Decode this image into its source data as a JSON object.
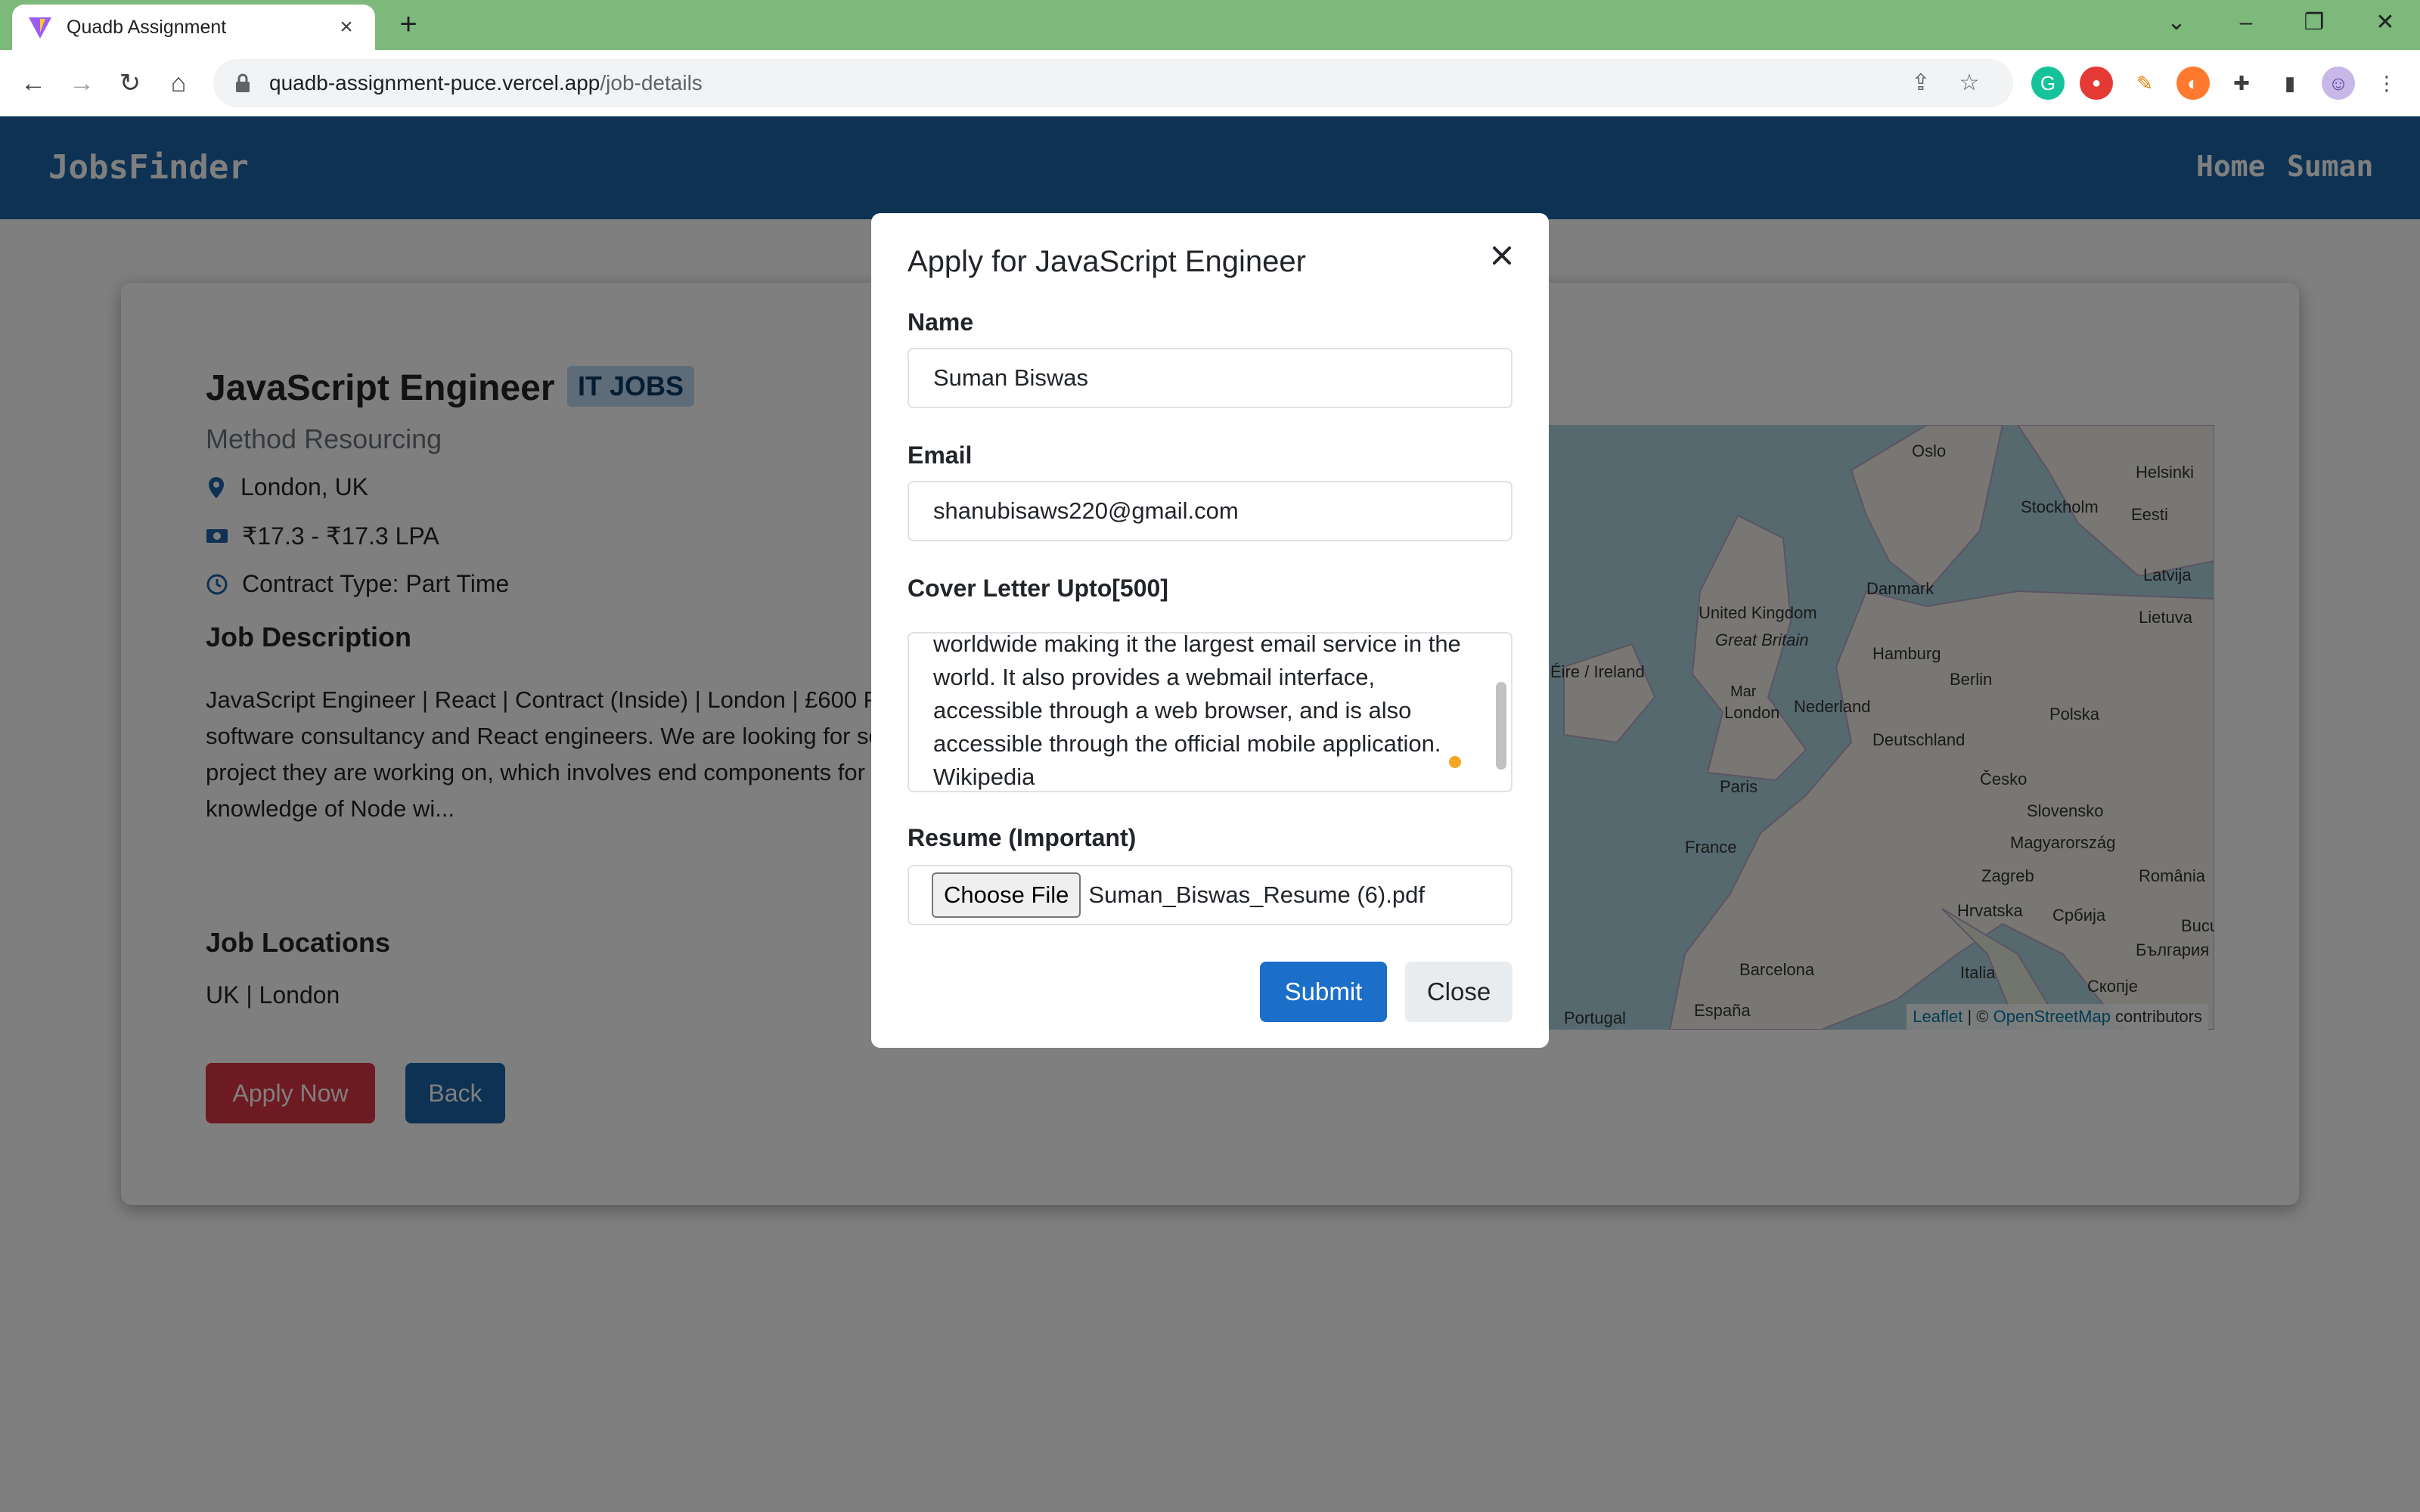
{
  "browser": {
    "tab_title": "Quadb Assignment",
    "url_host": "quadb-assignment-puce.vercel.app",
    "url_path": "/job-details"
  },
  "navbar": {
    "brand": "JobsFinder",
    "home": "Home",
    "user": "Suman"
  },
  "job": {
    "title": "JavaScript Engineer",
    "badge": "IT JOBS",
    "company": "Method Resourcing",
    "location": "London, UK",
    "salary": "₹17.3 - ₹17.3 LPA",
    "contract": "Contract Type: Part Time",
    "description_heading": "Job Description",
    "description": "JavaScript Engineer | React | Contract (Inside) | London | £600 P Method Resourcing has partnered with a software consultancy and React engineers. We are looking for somebody with very g TypeScript for the project they are working on, which involves end components for their end-clients. The task will involve a M knowledge of Node wi...",
    "locations_heading": "Job Locations",
    "locations": "UK | London",
    "apply_label": "Apply Now",
    "back_label": "Back"
  },
  "map": {
    "labels": [
      "Oslo",
      "Helsinki",
      "Stockholm",
      "Eesti",
      "Latvija",
      "Lietuva",
      "Danmark",
      "United Kingdom",
      "Great Britain",
      "Éire / Ireland",
      "Hamburg",
      "Berlin",
      "Nederland",
      "Polska",
      "London",
      "Deutschland",
      "Česko",
      "Paris",
      "Slovensko",
      "France",
      "Magyarország",
      "Zagreb",
      "România",
      "Hrvatska",
      "Србија",
      "Bucu",
      "България",
      "Barcelona",
      "Italia",
      "Скопје",
      "España",
      "Portugal"
    ],
    "marker_alt": "Mar",
    "attribution_leaflet": "Leaflet",
    "attribution_sep": " | © ",
    "attribution_osm": "OpenStreetMap",
    "attribution_tail": " contributors"
  },
  "modal": {
    "title": "Apply for JavaScript Engineer",
    "name_label": "Name",
    "name_value": "Suman Biswas",
    "email_label": "Email",
    "email_value": "shanubisaws220@gmail.com",
    "cover_label": "Cover Letter Upto[500]",
    "cover_value": "worldwide making it the largest email service in the world. It also provides a webmail interface, accessible through a web browser, and is also accessible through the official mobile application. Wikipedia",
    "resume_label": "Resume (Important)",
    "choose_file": "Choose File",
    "file_name": "Suman_Biswas_Resume (6).pdf",
    "submit": "Submit",
    "close": "Close"
  }
}
